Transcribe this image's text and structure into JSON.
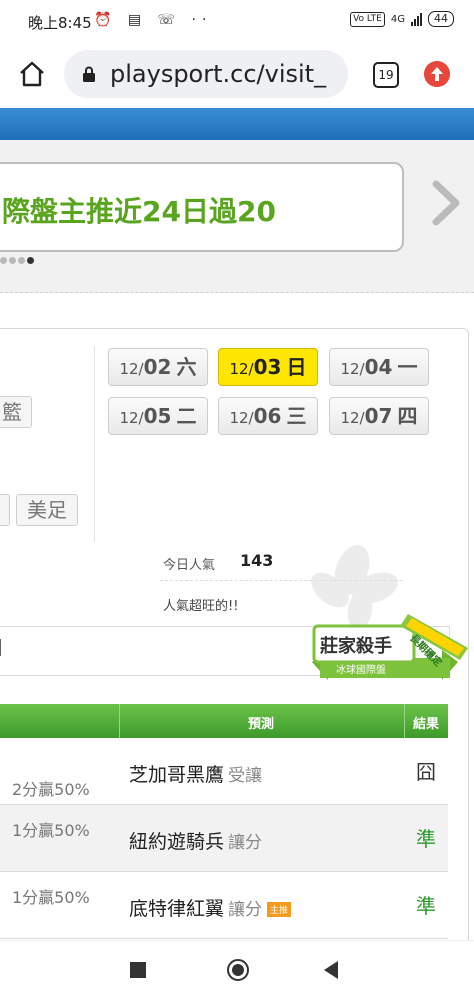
{
  "status_bar": {
    "time": "晚上8:45",
    "battery": "44",
    "network": "4G",
    "volte": "Vo LTE"
  },
  "browser": {
    "url": "playsport.cc/visit_",
    "tab_count": "19"
  },
  "banner": {
    "text": "際盤主推近24日過20"
  },
  "sports": [
    "籃",
    "",
    "美足"
  ],
  "dates": [
    {
      "md": "12/",
      "day": "02",
      "wd": "六",
      "active": false
    },
    {
      "md": "12/",
      "day": "03",
      "wd": "日",
      "active": true
    },
    {
      "md": "12/",
      "day": "04",
      "wd": "一",
      "active": false
    },
    {
      "md": "12/",
      "day": "05",
      "wd": "二",
      "active": false
    },
    {
      "md": "12/",
      "day": "06",
      "wd": "三",
      "active": false
    },
    {
      "md": "12/",
      "day": "07",
      "wd": "四",
      "active": false
    }
  ],
  "popularity": {
    "label": "今日人氣",
    "count": "143",
    "note": "人氣超旺的!!"
  },
  "section_title": "l",
  "badge": {
    "title": "莊家殺手",
    "subtitle": "冰球國際盤",
    "ribbon": "長期穩定"
  },
  "table": {
    "headers": {
      "predict": "預測",
      "result": "結果"
    },
    "rows": [
      {
        "odds": "2分贏50%",
        "team": "芝加哥黑鷹",
        "tag": "受讓",
        "master": "",
        "result": "囧",
        "result_type": "lose"
      },
      {
        "odds": "1分贏50%",
        "team": "紐約遊騎兵",
        "tag": "讓分",
        "master": "",
        "result": "準",
        "result_type": "win"
      },
      {
        "odds": "1分贏50%",
        "team": "底特律紅翼",
        "tag": "讓分",
        "master": "主推",
        "result": "準",
        "result_type": "win"
      }
    ]
  }
}
